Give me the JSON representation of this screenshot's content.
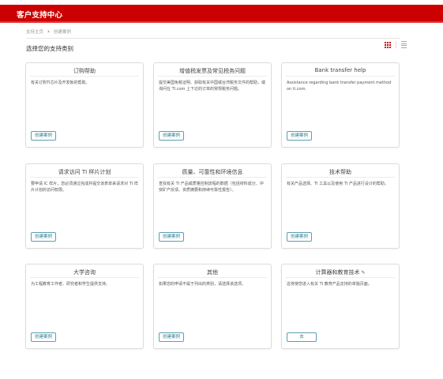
{
  "header": {
    "title": "客户支持中心"
  },
  "breadcrumb": {
    "home": "支持主页",
    "separator": "›",
    "current": "创建案例"
  },
  "section_title": "选择您的支持类别",
  "view_toggle": {
    "grid_icon": "grid-icon",
    "list_icon": "list-icon",
    "active": "grid"
  },
  "colors": {
    "brand_red": "#cc0000",
    "button_border": "#5a9fb0"
  },
  "cards": [
    {
      "title": "订购帮助",
      "desc": "有关订购TI芯片及开发板的帮助。",
      "button": "创建案例"
    },
    {
      "title": "增值税发票及常见税务问题",
      "desc": "提交美国免税证明、获取有关中国或台湾税务文件的帮助，或询问在 TI.com 上下达的订单的常规税务问题。",
      "button": "创建案例"
    },
    {
      "title": "Bank transfer help",
      "desc": "Assistance regarding bank transfer payment method on ti.com.",
      "button": "创建案例"
    },
    {
      "title": "请求访问 TI 样片计划",
      "desc": "要申请 IC 样片，您必须通过完成并提交该表单来请求对 TI 样片计划的访问权限。",
      "button": "创建案例"
    },
    {
      "title": "质量、可靠性和环境信息",
      "desc": "查找有关 TI 产品或质量控制流程的数据（包括材料成分、冲突矿产反馈、资质摘要和持续可靠性报告）。",
      "button": "创建案例"
    },
    {
      "title": "技术帮助",
      "desc": "有关产品选择、TI 工具以及使用 TI 产品进行设计的帮助。",
      "button": "创建案例"
    },
    {
      "title": "大学咨询",
      "desc": "为工程教育工作者、研究者和学生提供支持。",
      "button": "创建案例"
    },
    {
      "title": "其他",
      "desc": "如果您的申请不属于列出的类别，请选择该选项。",
      "button": "创建案例"
    },
    {
      "title": "计算器和教育技术",
      "desc": "这将使您进入有关 TI 教育产品支持的单独页面。",
      "button": "去",
      "title_icon": "pencil-icon"
    }
  ]
}
